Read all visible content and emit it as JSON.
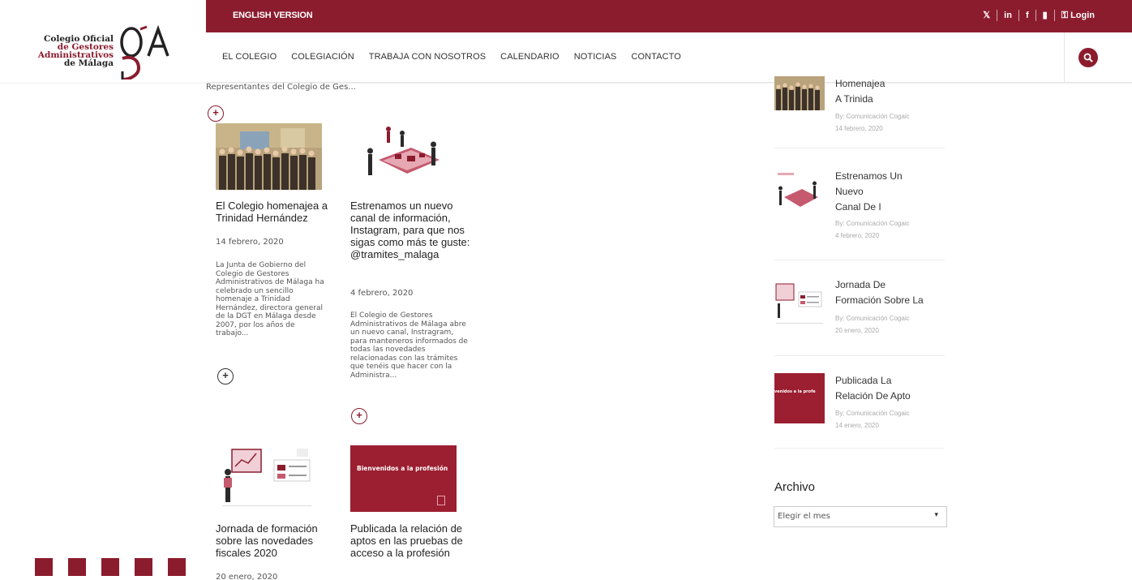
{
  "topbar": {
    "english": "ENGLISH VERSION",
    "social": [
      "twitter-icon",
      "linkedin-icon",
      "facebook-icon",
      "youtube-icon"
    ],
    "login": "Login"
  },
  "logo": {
    "line1": "Colegio Oficial",
    "line2": "de Gestores",
    "line3": "Administrativos",
    "line4": "de Málaga"
  },
  "nav": {
    "items": [
      "EL COLEGIO",
      "COLEGIACIÓN",
      "TRABAJA CON NOSOTROS",
      "CALENDARIO",
      "NOTICIAS",
      "CONTACTO"
    ]
  },
  "intro": "Representantes del Colegio de Ges...",
  "posts": [
    {
      "title": "El Colegio homenajea a Trinidad Hernández",
      "date": "14 febrero, 2020",
      "excerpt": "La Junta de Gobierno del Colegio de Gestores Administrativos de Málaga ha celebrado un sencillo homenaje a Trinidad Hernández, directora general de la DGT en Málaga desde 2007, por los años de trabajo..."
    },
    {
      "title": "Estrenamos un nuevo canal de información, Instagram, para que nos sigas como más te guste: @tramites_malaga",
      "date": "4 febrero, 2020",
      "excerpt": "El Colegio de Gestores Administrativos de Málaga abre un nuevo canal, Instragram, para manteneros informados de todas las novedades relacionadas con las trámites que tenéis que hacer con la Administra..."
    },
    {
      "title": "Jornada de formación sobre las novedades fiscales 2020",
      "date": "20 enero, 2020"
    },
    {
      "title": "Publicada la relación de aptos en las pruebas de acceso a la profesión",
      "banner": "Bienvenidos a la profesión"
    }
  ],
  "sidebar": {
    "items": [
      {
        "title_lines": [
          "Homenajea",
          "A Trinida"
        ],
        "by": "By: Comunicación Cogaic",
        "date": "14 febrero, 2020"
      },
      {
        "title_lines": [
          "Estrenamos Un",
          "Nuevo",
          "Canal De I"
        ],
        "by": "By: Comunicación Cogaic",
        "date": "4 febrero, 2020"
      },
      {
        "title_lines": [
          "Jornada De",
          "Formación Sobre La"
        ],
        "by": "By: Comunicación Cogaic",
        "date": "20 enero, 2020"
      },
      {
        "title_lines": [
          "Publicada La",
          "Relación De Apto"
        ],
        "by": "By: Comunicación Cogaic",
        "date": "14 enero, 2020",
        "thumb_text": "venidos a la profe"
      }
    ],
    "archivo_title": "Archivo",
    "archivo_select": "Elegir el mes"
  },
  "colors": {
    "brand": "#8b1c2e"
  }
}
